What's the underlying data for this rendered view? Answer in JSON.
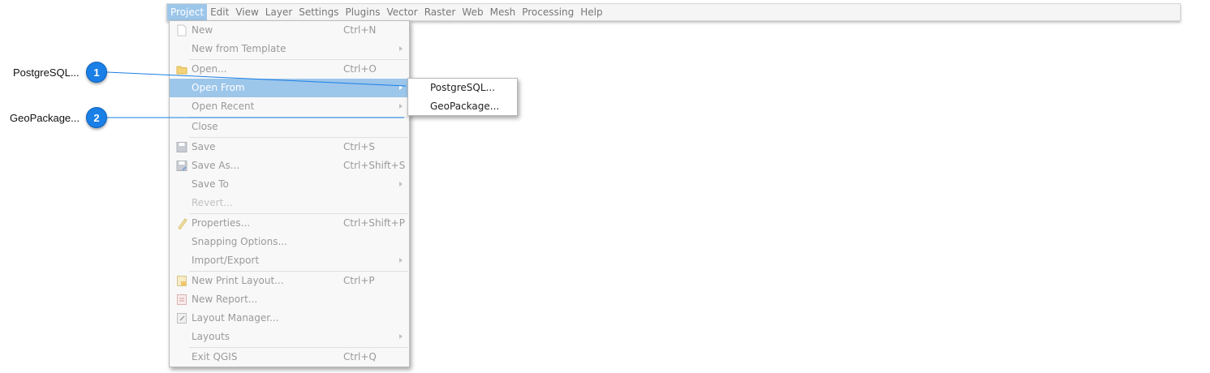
{
  "menubar": {
    "items": [
      {
        "label": "Project",
        "active": true
      },
      {
        "label": "Edit"
      },
      {
        "label": "View"
      },
      {
        "label": "Layer"
      },
      {
        "label": "Settings"
      },
      {
        "label": "Plugins"
      },
      {
        "label": "Vector"
      },
      {
        "label": "Raster"
      },
      {
        "label": "Web"
      },
      {
        "label": "Mesh"
      },
      {
        "label": "Processing"
      },
      {
        "label": "Help"
      }
    ]
  },
  "project_menu": {
    "items": [
      {
        "label": "New",
        "shortcut": "Ctrl+N",
        "icon": "new-file-icon"
      },
      {
        "label": "New from Template",
        "submenu": true
      },
      {
        "label": "Open...",
        "shortcut": "Ctrl+O",
        "icon": "open-folder-icon"
      },
      {
        "label": "Open From",
        "submenu": true,
        "highlighted": true
      },
      {
        "label": "Open Recent",
        "submenu": true
      },
      {
        "label": "Close"
      },
      {
        "label": "Save",
        "shortcut": "Ctrl+S",
        "icon": "save-icon"
      },
      {
        "label": "Save As...",
        "shortcut": "Ctrl+Shift+S",
        "icon": "save-as-icon"
      },
      {
        "label": "Save To",
        "submenu": true
      },
      {
        "label": "Revert...",
        "disabled": true
      },
      {
        "label": "Properties...",
        "shortcut": "Ctrl+Shift+P",
        "icon": "properties-icon"
      },
      {
        "label": "Snapping Options..."
      },
      {
        "label": "Import/Export",
        "submenu": true
      },
      {
        "label": "New Print Layout...",
        "shortcut": "Ctrl+P",
        "icon": "new-print-layout-icon"
      },
      {
        "label": "New Report...",
        "icon": "new-report-icon"
      },
      {
        "label": "Layout Manager...",
        "icon": "layout-manager-icon"
      },
      {
        "label": "Layouts",
        "submenu": true
      },
      {
        "label": "Exit QGIS",
        "shortcut": "Ctrl+Q"
      }
    ]
  },
  "open_from_submenu": {
    "items": [
      {
        "label": "PostgreSQL..."
      },
      {
        "label": "GeoPackage..."
      }
    ]
  },
  "callouts": [
    {
      "number": "1",
      "label": "PostgreSQL..."
    },
    {
      "number": "2",
      "label": "GeoPackage..."
    }
  ],
  "colors": {
    "highlight": "#9cc6ea",
    "badge": "#1a7fe6",
    "callout_line": "#1a7fe6"
  }
}
